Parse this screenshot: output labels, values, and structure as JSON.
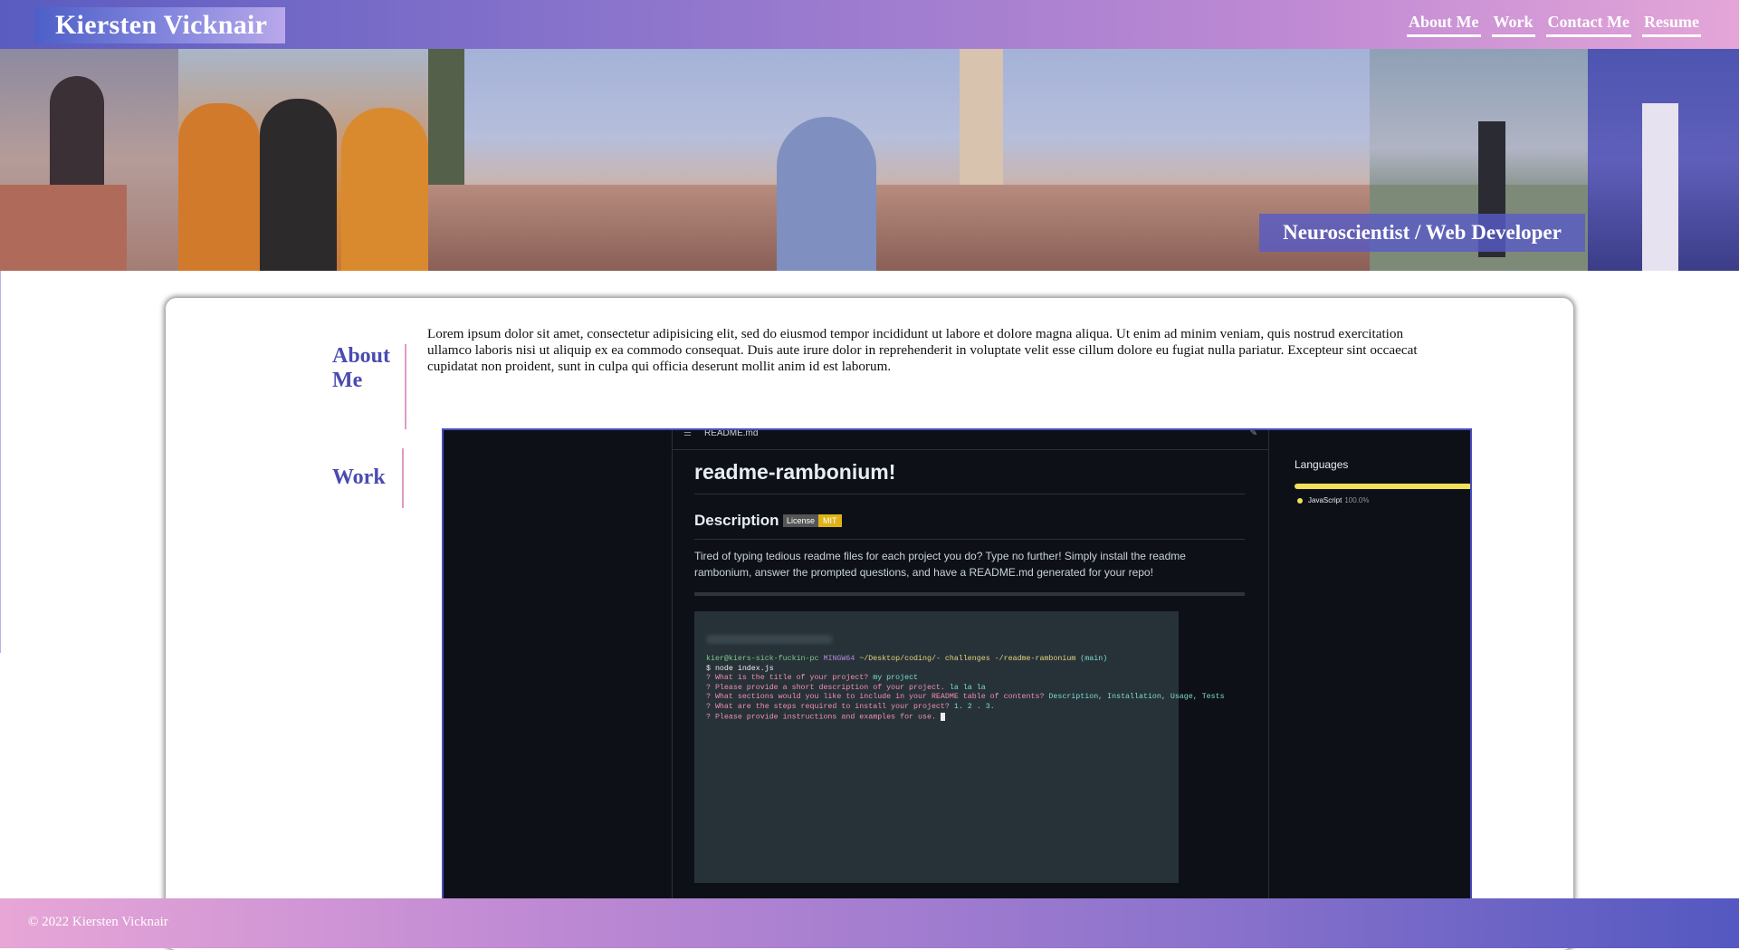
{
  "header": {
    "brand": "Kiersten Vicknair",
    "nav": [
      "About Me",
      "Work",
      "Contact Me",
      "Resume"
    ]
  },
  "banner": {
    "tagline": "Neuroscientist / Web Developer"
  },
  "about": {
    "title": "About Me",
    "text": "Lorem ipsum dolor sit amet, consectetur adipisicing elit, sed do eiusmod tempor incididunt ut labore et dolore magna aliqua. Ut enim ad minim veniam, quis nostrud exercitation ullamco laboris nisi ut aliquip ex ea commodo consequat. Duis aute irure dolor in reprehenderit in voluptate velit esse cillum dolore eu fugiat nulla pariatur. Excepteur sint occaecat cupidatat non proident, sunt in culpa qui officia deserunt mollit anim id est laborum."
  },
  "work": {
    "title": "Work",
    "screenshot": {
      "file_name": "README.md",
      "heading": "readme-rambonium!",
      "subheading": "Description",
      "badge_label": "License",
      "badge_value": "MIT",
      "description": "Tired of typing tedious readme files for each project you do? Type no further! Simply install the readme rambonium, answer the prompted questions, and have a README.md generated for your repo!",
      "terminal": {
        "user": "kier@kiers-sick-fuckin-pc",
        "env": "MINGW64",
        "path": "~/Desktop/coding/- challenges -/readme-rambonium",
        "branch": "(main)",
        "command": "$ node index.js",
        "q1": "? What is the title of your project?",
        "a1": "my project",
        "q2": "? Please provide a short description of your project.",
        "a2": "la la la",
        "q3": "? What sections would you like to include in your README table of contents?",
        "a3": "Description, Installation, Usage, Tests",
        "q4": "? What are the steps required to install your project?",
        "a4": "1. 2 . 3.",
        "q5": "? Please provide instructions and examples for use."
      },
      "languages_title": "Languages",
      "language_name": "JavaScript",
      "language_pct": "100.0%"
    }
  },
  "footer": {
    "text": "© 2022 Kiersten Vicknair"
  },
  "colors": {
    "accent": "#4a4cb0",
    "divider": "#e09ac6",
    "gradient_start": "#5a5cc0",
    "gradient_end": "#e4a6d8"
  }
}
